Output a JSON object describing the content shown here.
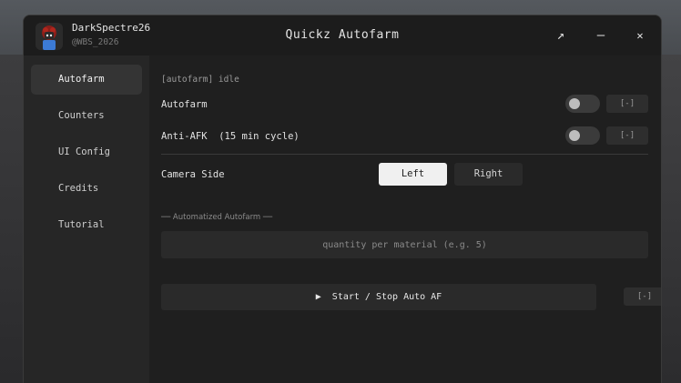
{
  "user": {
    "name": "DarkSpectre26",
    "handle": "@WBS_2026"
  },
  "window": {
    "title": "Quickz Autofarm",
    "popout_icon": "↗",
    "minimize_icon": "—",
    "close_icon": "✕"
  },
  "sidebar": {
    "items": [
      {
        "label": "Autofarm",
        "active": true
      },
      {
        "label": "Counters",
        "active": false
      },
      {
        "label": "UI Config",
        "active": false
      },
      {
        "label": "Credits",
        "active": false
      },
      {
        "label": "Tutorial",
        "active": false
      }
    ]
  },
  "main": {
    "status": "[autofarm] idle",
    "autofarm": {
      "label": "Autofarm",
      "enabled": false,
      "keybind": "[-]"
    },
    "anti_afk": {
      "label": "Anti-AFK  (15 min cycle)",
      "enabled": false,
      "keybind": "[-]"
    },
    "camera_side": {
      "label": "Camera Side",
      "options": [
        "Left",
        "Right"
      ],
      "selected": "Left"
    },
    "section_title": "── Automatized Autofarm ──",
    "quantity_input": {
      "placeholder": "quantity per material (e.g. 5)",
      "value": ""
    },
    "start_button": {
      "icon": "▶",
      "label": "Start / Stop Auto AF",
      "keybind": "[-]"
    }
  },
  "colors": {
    "window_bg": "#1e1e1e",
    "sidebar_bg": "#262626",
    "accent_selected": "#f0f0f0"
  }
}
